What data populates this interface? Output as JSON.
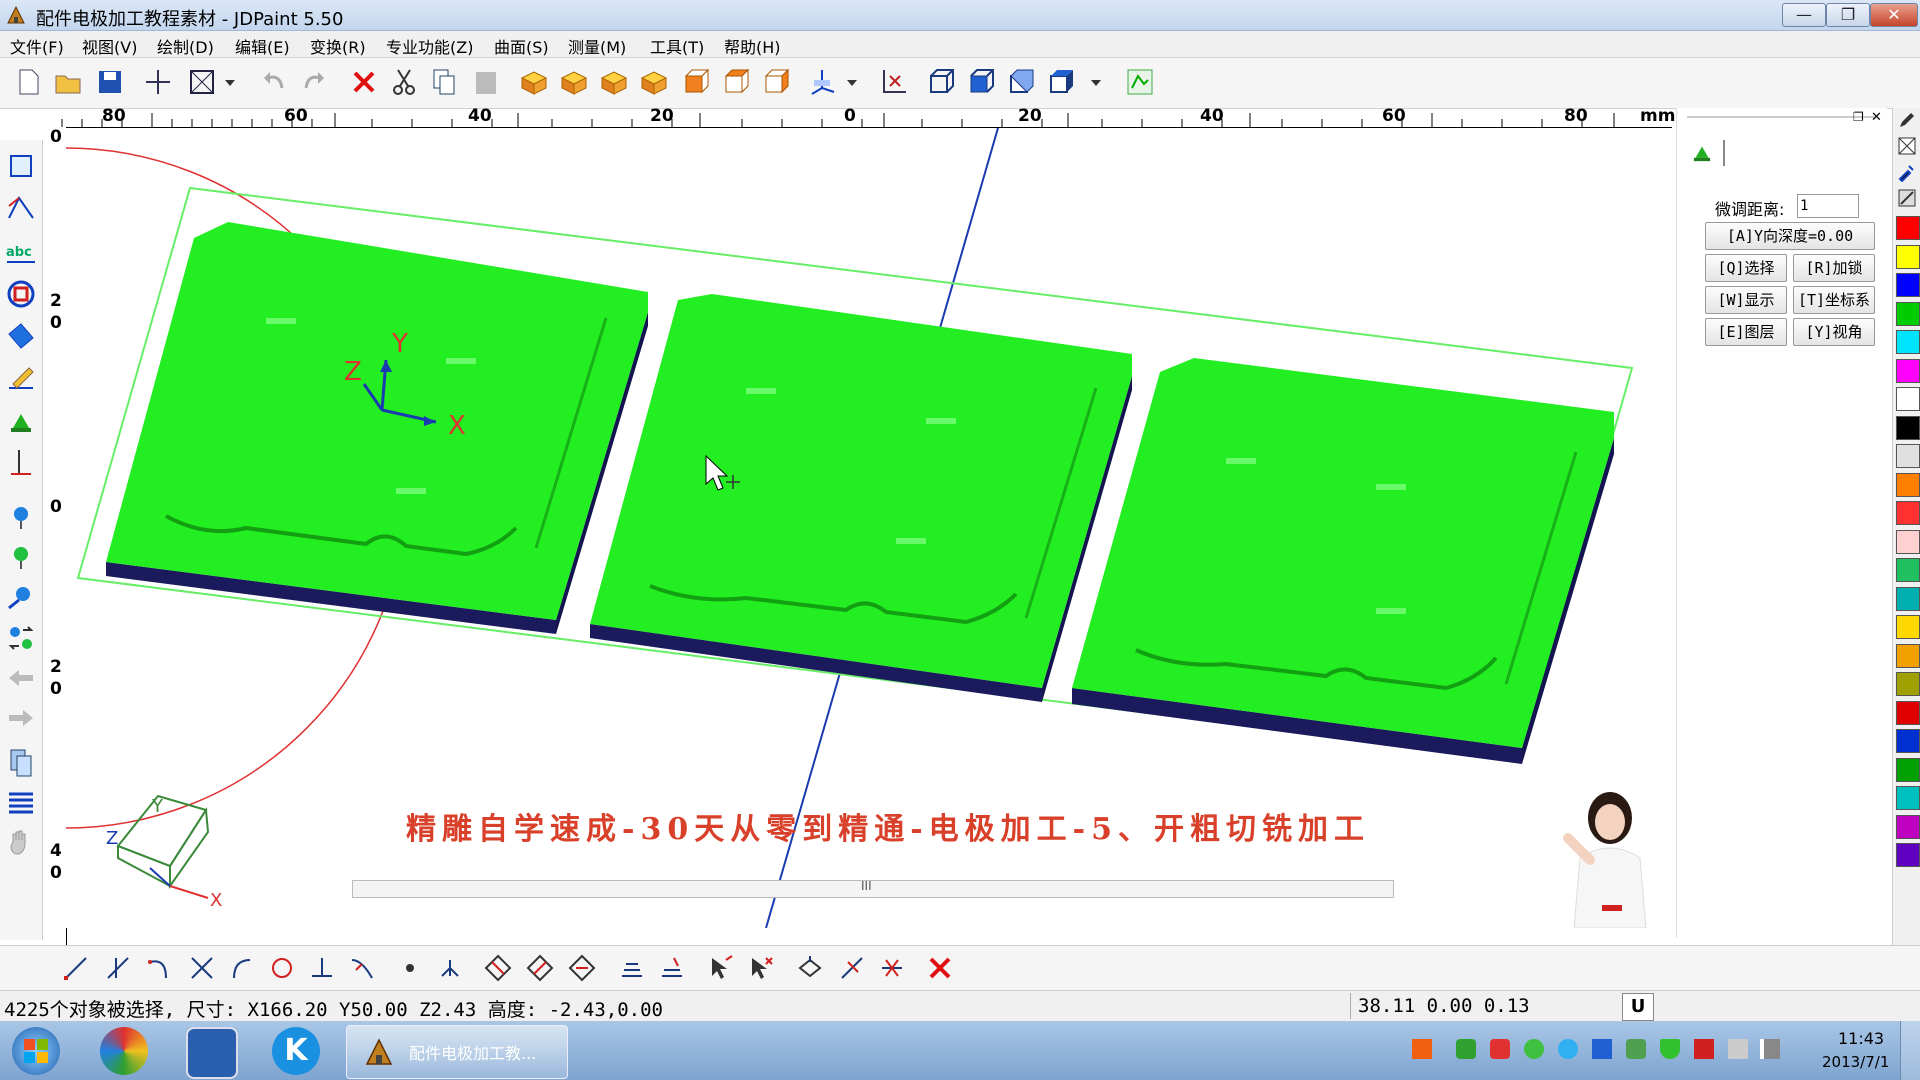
{
  "window": {
    "title": "配件电极加工教程素材 - JDPaint 5.50",
    "minimize": "—",
    "maximize": "❐",
    "close": "✕"
  },
  "menu": [
    {
      "label": "文件(F)"
    },
    {
      "label": "视图(V)"
    },
    {
      "label": "绘制(D)"
    },
    {
      "label": "编辑(E)"
    },
    {
      "label": "变换(R)"
    },
    {
      "label": "专业功能(Z)"
    },
    {
      "label": "曲面(S)"
    },
    {
      "label": "测量(M)"
    },
    {
      "label": "工具(T)"
    },
    {
      "label": "帮助(H)"
    }
  ],
  "ruler": {
    "ticks": [
      "80",
      "60",
      "40",
      "20",
      "0",
      "20",
      "40",
      "60",
      "80"
    ],
    "unit": "mm",
    "vticks": [
      "0",
      "2",
      "0",
      "0",
      "2",
      "0",
      "4",
      "0"
    ]
  },
  "viewport": {
    "axis_x": "X",
    "axis_y": "Y",
    "axis_z": "Z",
    "cube_x": "X",
    "cube_y": "Y",
    "cube_z": "Z",
    "caption": "精雕自学速成-30天从零到精通-电极加工-5、开粗切铣加工",
    "scroll_thumb": "III"
  },
  "rightpanel": {
    "fine_label": "微调距离:",
    "fine_value": "1",
    "depth_btn": "[A]Y向深度=0.00",
    "buttons": [
      "[Q]选择",
      "[R]加锁",
      "[W]显示",
      "[T]坐标系",
      "[E]图层",
      "[Y]视角"
    ]
  },
  "palette": [
    "#ff0000",
    "#ffff00",
    "#0000ff",
    "#00cc00",
    "#00e5ff",
    "#ff00ff",
    "#ffffff",
    "#000000",
    "#e0e0e0",
    "#ff8000",
    "#ff3030",
    "#ffd0d0",
    "#20c060",
    "#00b0b0",
    "#ffd800",
    "#f0a000",
    "#a0a000",
    "#e00000",
    "#0030d0",
    "#00a000",
    "#00c0c0",
    "#c000c0",
    "#6000c0"
  ],
  "status": {
    "selection": "4225个对象被选择, 尺寸: X166.20 Y50.00 Z2.43 高度: -2.43,0.00",
    "coords": "38.11  0.00  0.13",
    "mode": "U"
  },
  "taskbar": {
    "app_label": "配件电极加工教...",
    "time": "11:43",
    "date": "2013/7/1"
  },
  "colors": {
    "model": "#22ee22",
    "base": "#1a1a5c",
    "frame": "#66ee66"
  }
}
